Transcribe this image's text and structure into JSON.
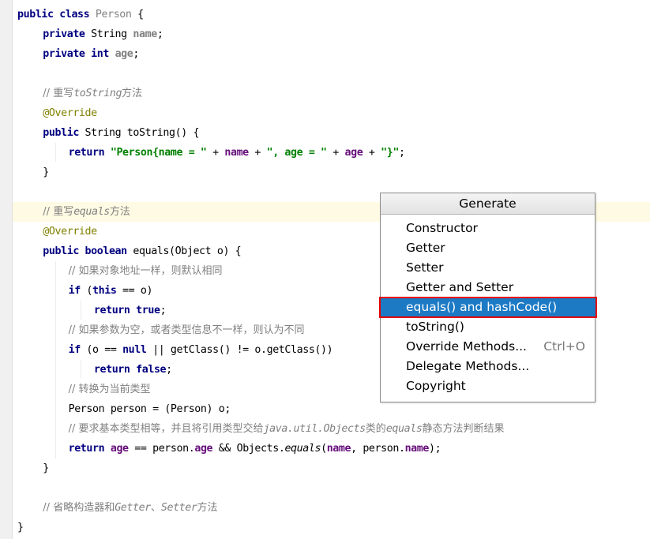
{
  "editor": {
    "current_line_index": 10,
    "lines": [
      [
        [
          0,
          "k",
          "public class "
        ],
        [
          0,
          "u",
          "Person"
        ],
        [
          0,
          "t",
          " {"
        ]
      ],
      [
        [
          1,
          "k",
          "private "
        ],
        [
          1,
          "t",
          "String "
        ],
        [
          1,
          "ub",
          "name"
        ],
        [
          1,
          "t",
          ";"
        ]
      ],
      [
        [
          1,
          "k",
          "private int "
        ],
        [
          1,
          "ub",
          "age"
        ],
        [
          1,
          "t",
          ";"
        ]
      ],
      [],
      [
        [
          1,
          "c",
          "// 重写"
        ],
        [
          1,
          "ci",
          "toString"
        ],
        [
          1,
          "c",
          "方法"
        ]
      ],
      [
        [
          1,
          "a",
          "@Override"
        ]
      ],
      [
        [
          1,
          "k",
          "public "
        ],
        [
          1,
          "t",
          "String toString() {"
        ]
      ],
      [
        [
          2,
          "k",
          "return "
        ],
        [
          2,
          "s",
          "\"Person{name = \""
        ],
        [
          2,
          "t",
          " + "
        ],
        [
          2,
          "f",
          "name"
        ],
        [
          2,
          "t",
          " + "
        ],
        [
          2,
          "s",
          "\", age = \""
        ],
        [
          2,
          "t",
          " + "
        ],
        [
          2,
          "f",
          "age"
        ],
        [
          2,
          "t",
          " + "
        ],
        [
          2,
          "s",
          "\"}\""
        ],
        [
          2,
          "t",
          ";"
        ]
      ],
      [
        [
          1,
          "t",
          "}"
        ]
      ],
      [],
      [
        [
          1,
          "c",
          "// 重写"
        ],
        [
          1,
          "ci",
          "equals"
        ],
        [
          1,
          "c",
          "方法"
        ]
      ],
      [
        [
          1,
          "a",
          "@Override"
        ]
      ],
      [
        [
          1,
          "k",
          "public boolean "
        ],
        [
          1,
          "t",
          "equals(Object o) {"
        ]
      ],
      [
        [
          2,
          "c",
          "// 如果对象地址一样，则默认相同"
        ]
      ],
      [
        [
          2,
          "k",
          "if "
        ],
        [
          2,
          "t",
          "("
        ],
        [
          2,
          "k",
          "this"
        ],
        [
          2,
          "t",
          " == o)"
        ]
      ],
      [
        [
          3,
          "k",
          "return true"
        ],
        [
          3,
          "t",
          ";"
        ]
      ],
      [
        [
          2,
          "c",
          "// 如果参数为空，或者类型信息不一样，则认为不同"
        ]
      ],
      [
        [
          2,
          "k",
          "if "
        ],
        [
          2,
          "t",
          "(o == "
        ],
        [
          2,
          "k",
          "null"
        ],
        [
          2,
          "t",
          " || getClass() != o.getClass())"
        ]
      ],
      [
        [
          3,
          "k",
          "return false"
        ],
        [
          3,
          "t",
          ";"
        ]
      ],
      [
        [
          2,
          "c",
          "// 转换为当前类型"
        ]
      ],
      [
        [
          2,
          "t",
          "Person person = (Person) o;"
        ]
      ],
      [
        [
          2,
          "c",
          "// 要求基本类型相等，并且将引用类型交给"
        ],
        [
          2,
          "ci",
          "java.util.Objects"
        ],
        [
          2,
          "c",
          "类的"
        ],
        [
          2,
          "ci",
          "equals"
        ],
        [
          2,
          "c",
          "静态方法判断结果"
        ]
      ],
      [
        [
          2,
          "k",
          "return "
        ],
        [
          2,
          "f",
          "age"
        ],
        [
          2,
          "t",
          " == person."
        ],
        [
          2,
          "f",
          "age"
        ],
        [
          2,
          "t",
          " && Objects."
        ],
        [
          2,
          "i",
          "equals"
        ],
        [
          2,
          "t",
          "("
        ],
        [
          2,
          "f",
          "name"
        ],
        [
          2,
          "t",
          ", person."
        ],
        [
          2,
          "f",
          "name"
        ],
        [
          2,
          "t",
          ");"
        ]
      ],
      [
        [
          1,
          "t",
          "}"
        ]
      ],
      [],
      [
        [
          1,
          "c",
          "// 省略构造器和"
        ],
        [
          1,
          "ci",
          "Getter"
        ],
        [
          1,
          "c",
          "、"
        ],
        [
          1,
          "ci",
          "Setter"
        ],
        [
          1,
          "c",
          "方法"
        ]
      ],
      [
        [
          0,
          "t",
          "}"
        ]
      ]
    ]
  },
  "generate_popup": {
    "title": "Generate",
    "selected_index": 4,
    "items": [
      {
        "label": "Constructor",
        "shortcut": ""
      },
      {
        "label": "Getter",
        "shortcut": ""
      },
      {
        "label": "Setter",
        "shortcut": ""
      },
      {
        "label": "Getter and Setter",
        "shortcut": ""
      },
      {
        "label": "equals() and hashCode()",
        "shortcut": ""
      },
      {
        "label": "toString()",
        "shortcut": ""
      },
      {
        "label": "Override Methods...",
        "shortcut": "Ctrl+O"
      },
      {
        "label": "Delegate Methods...",
        "shortcut": ""
      },
      {
        "label": "Copyright",
        "shortcut": ""
      }
    ],
    "colors": {
      "selection": "#1c7ac5",
      "highlight_border": "#e60000"
    }
  }
}
